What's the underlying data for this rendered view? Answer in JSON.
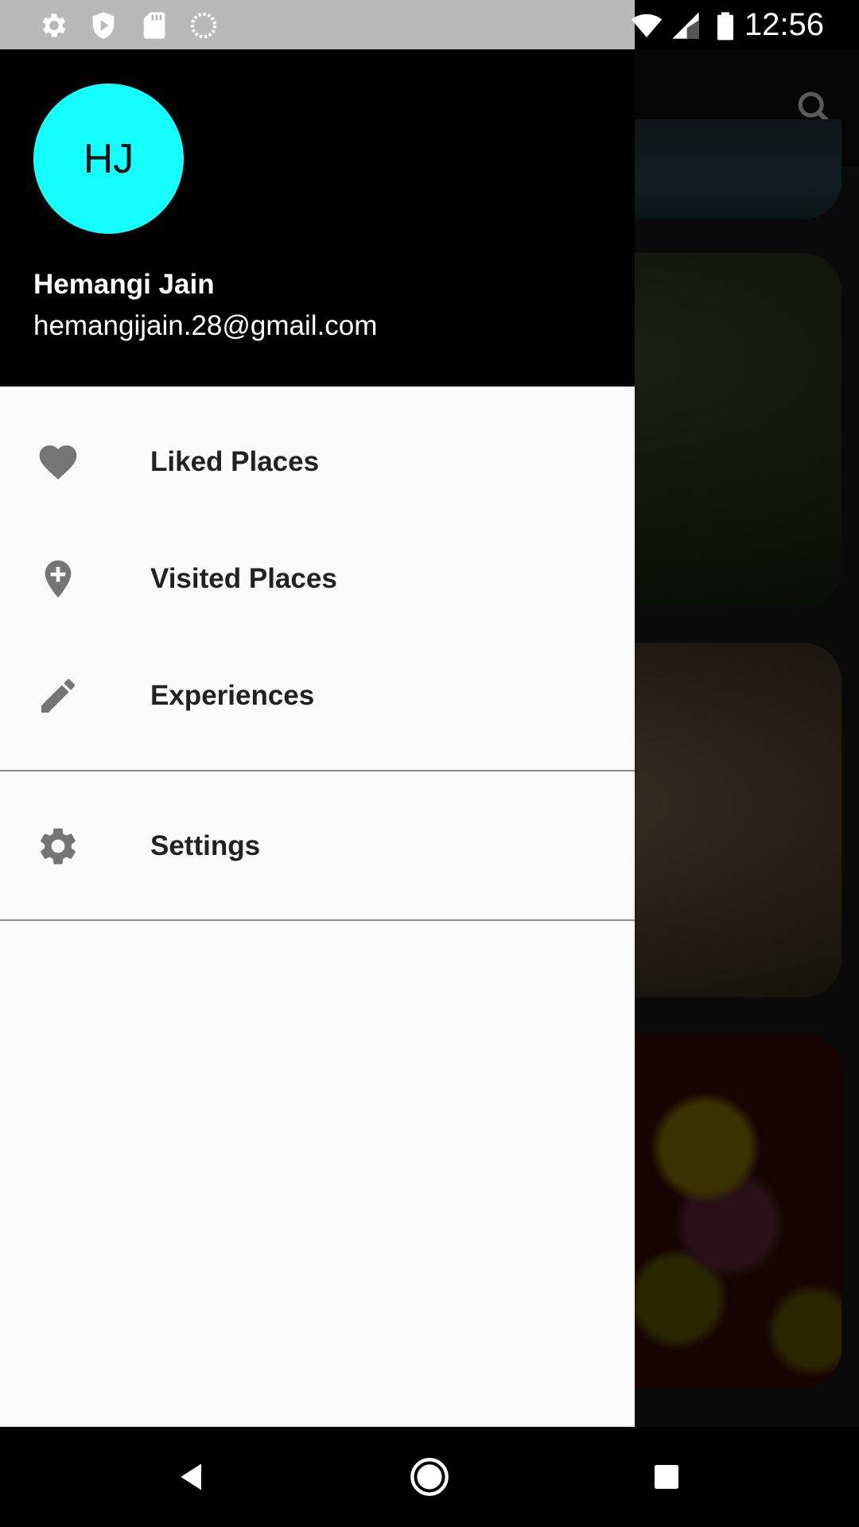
{
  "status_bar": {
    "time": "12:56",
    "left_icons": [
      "settings-icon",
      "shield-play-icon",
      "sd-card-icon",
      "loading-circle-icon"
    ],
    "right_icons": [
      "wifi-icon",
      "cellular-signal-icon",
      "battery-icon"
    ]
  },
  "app": {
    "toolbar_icons": [
      "search-icon"
    ]
  },
  "drawer": {
    "avatar_initials": "HJ",
    "avatar_color": "#16ffff",
    "user_name": "Hemangi Jain",
    "user_email": "hemangijain.28@gmail.com",
    "items": [
      {
        "icon": "heart-icon",
        "label": "Liked Places"
      },
      {
        "icon": "add-location-icon",
        "label": "Visited Places"
      },
      {
        "icon": "pencil-icon",
        "label": "Experiences"
      },
      {
        "icon": "gear-icon",
        "label": "Settings"
      }
    ]
  },
  "nav_bar": {
    "buttons": [
      "back-icon",
      "home-icon",
      "recents-icon"
    ]
  }
}
